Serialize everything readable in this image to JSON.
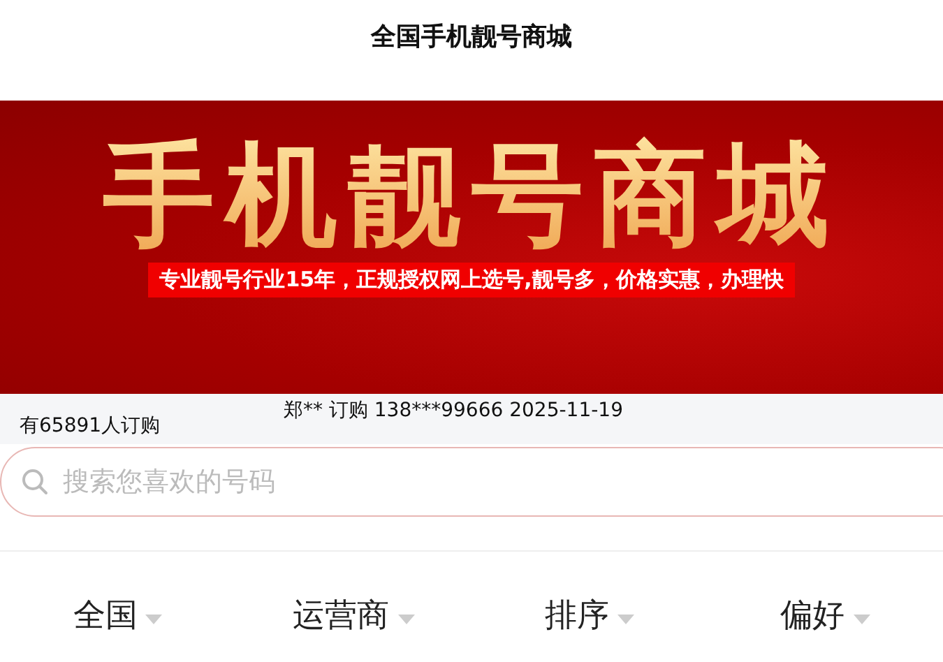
{
  "header": {
    "title": "全国手机靓号商城"
  },
  "banner": {
    "headline": "手机靓号商城",
    "slogan": "专业靓号行业15年，正规授权网上选号,靓号多，价格实惠，办理快"
  },
  "ticker": {
    "count_text": "有65891人订购",
    "latest_order": "郑** 订购 138***99666 2025-11-19"
  },
  "search": {
    "placeholder": "搜索您喜欢的号码"
  },
  "filters": [
    {
      "label": "全国"
    },
    {
      "label": "运营商"
    },
    {
      "label": "排序"
    },
    {
      "label": "偏好"
    }
  ]
}
